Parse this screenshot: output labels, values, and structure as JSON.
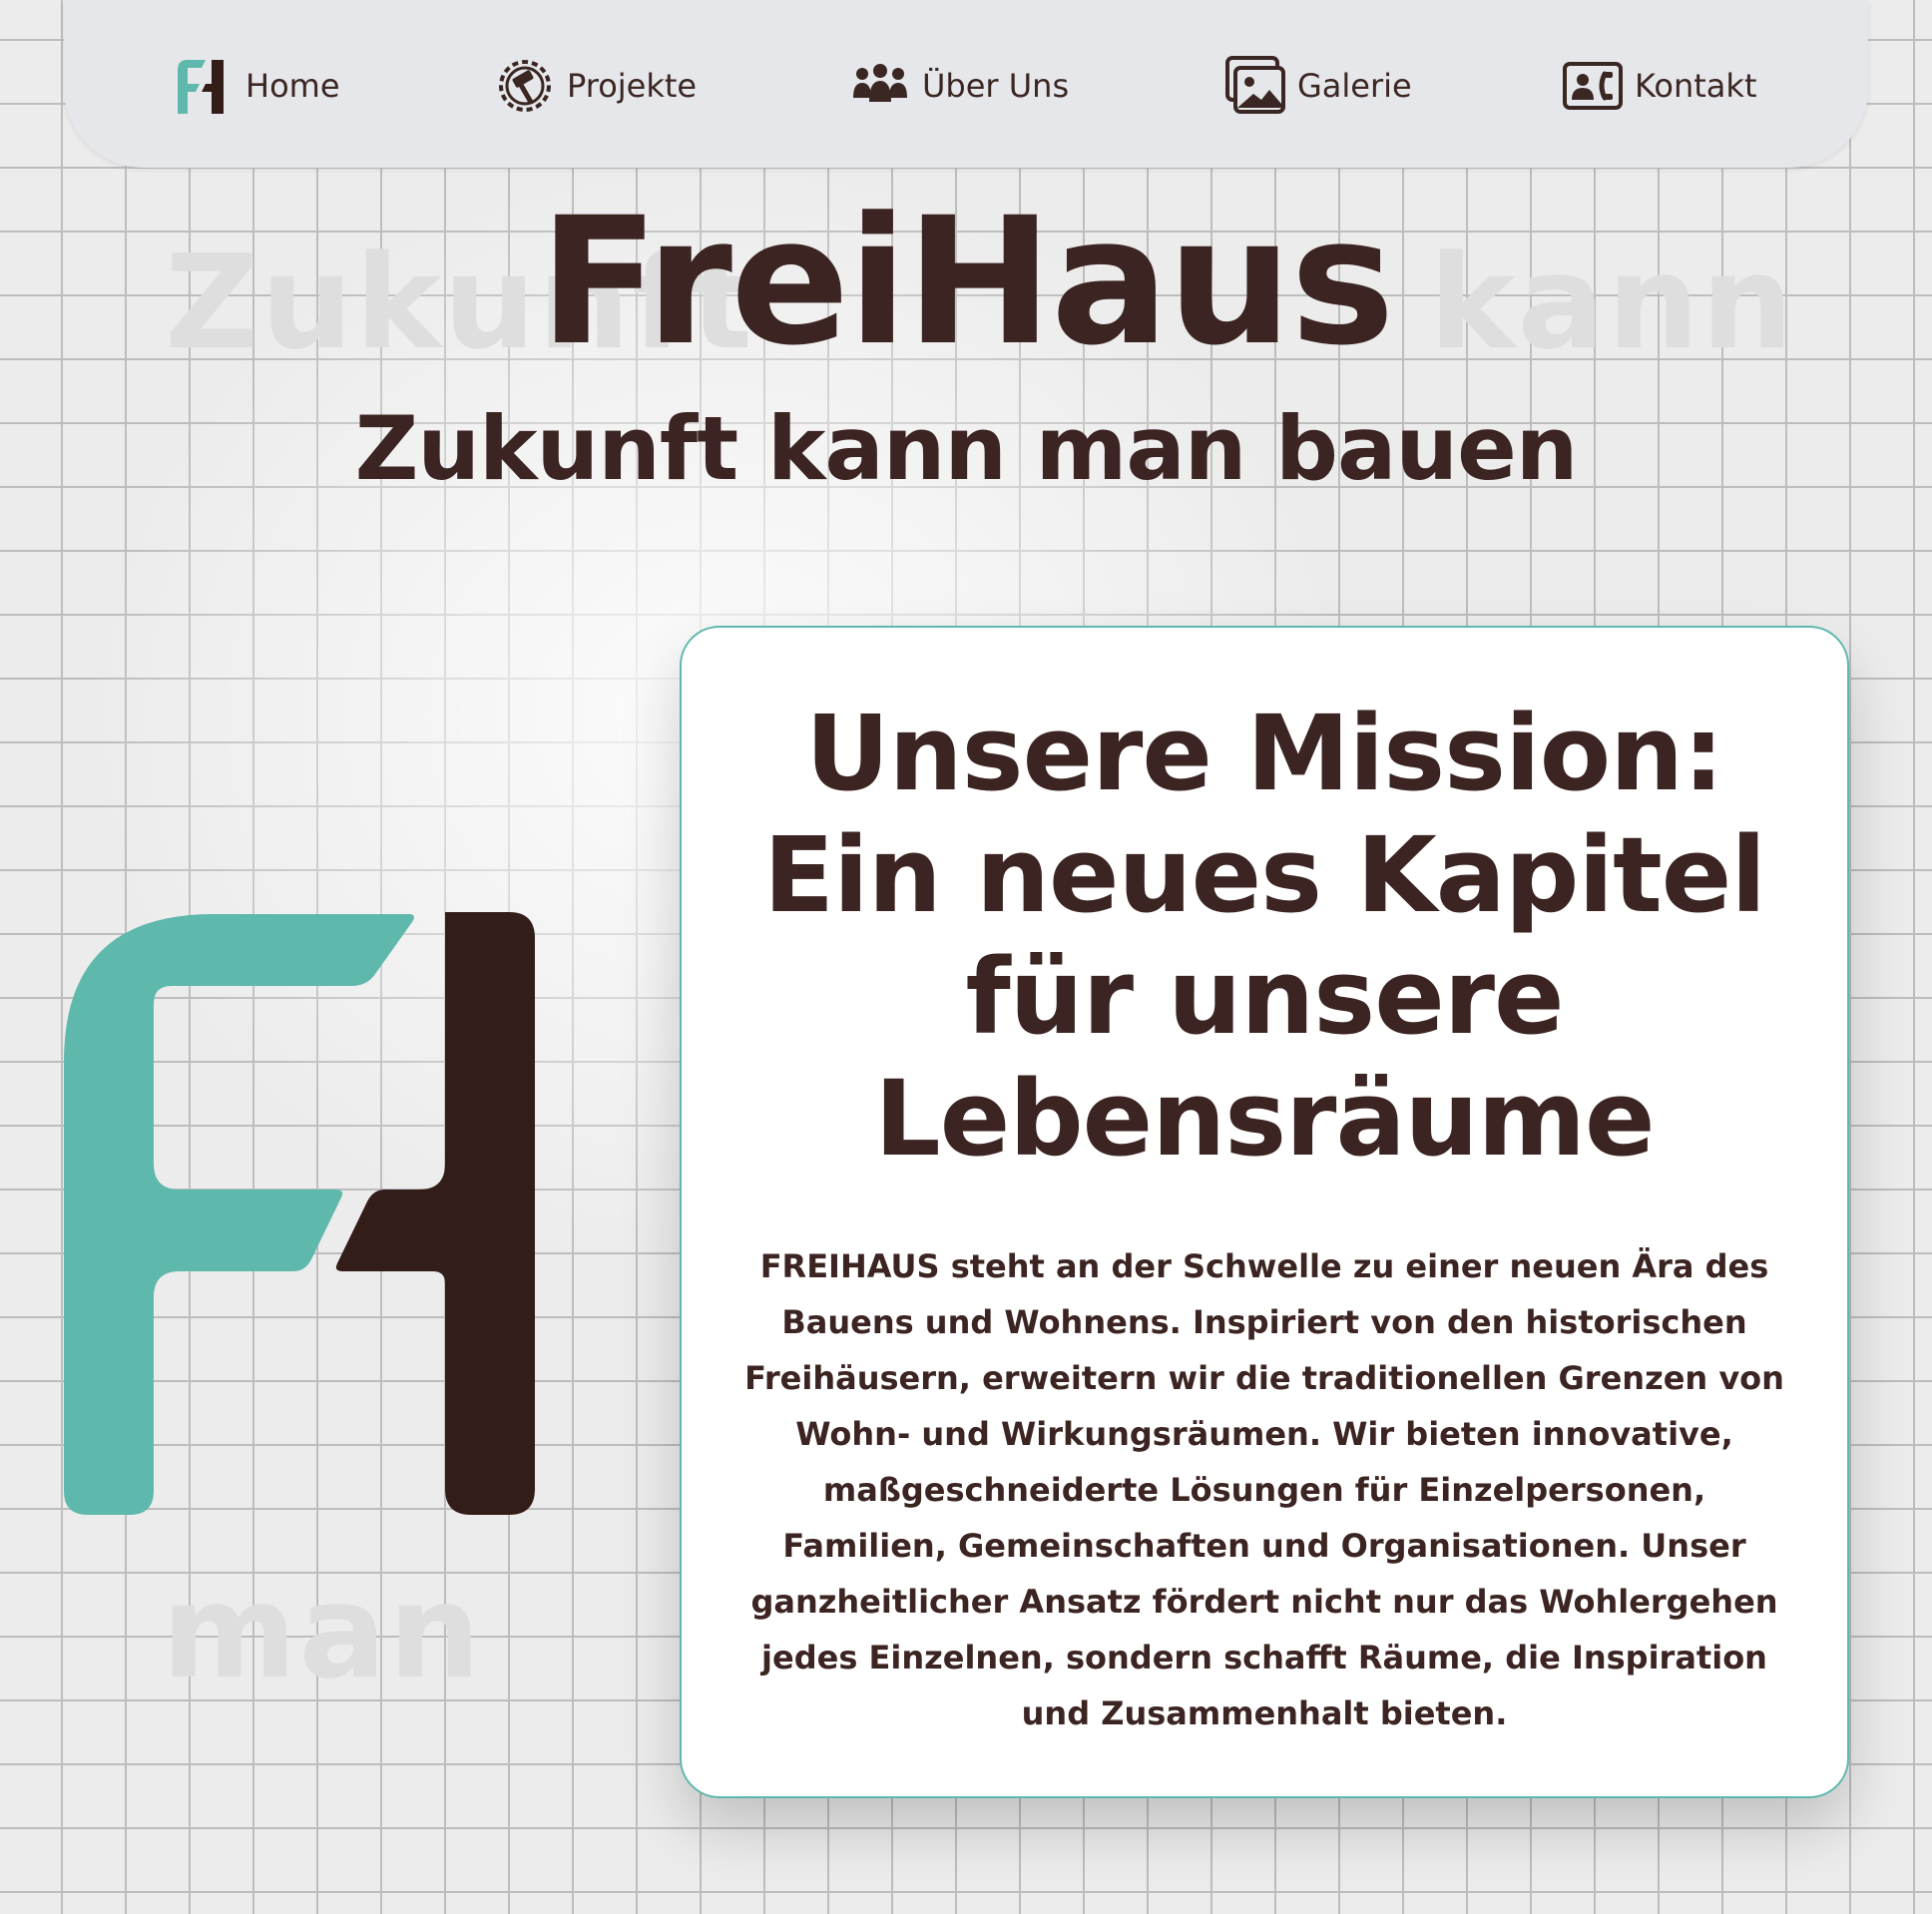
{
  "nav": {
    "items": [
      {
        "label": "Home",
        "icon": "fh-logo-icon"
      },
      {
        "label": "Projekte",
        "icon": "hammer-gear-icon"
      },
      {
        "label": "Über Uns",
        "icon": "group-icon"
      },
      {
        "label": "Galerie",
        "icon": "gallery-icon"
      },
      {
        "label": "Kontakt",
        "icon": "contact-card-icon"
      }
    ]
  },
  "hero": {
    "title": "FreiHaus",
    "subtitle": "Zukunft kann man bauen"
  },
  "mission": {
    "title": "Unsere Mission: Ein neues Kapitel für unsere Lebensräume",
    "body": "FREIHAUS steht an der Schwelle zu einer neuen Ära des Bauens und Wohnens. Inspiriert von den historischen Freihäusern, erweitern wir die traditionellen Grenzen von Wohn- und Wirkungsräumen. Wir bieten innovative, maßgeschneiderte Lösungen für Einzelpersonen, Familien, Gemeinschaften und Organisationen. Unser ganzheitlicher Ansatz fördert nicht nur das Wohlergehen jedes Einzelnen, sondern schafft Räume, die Inspiration und Zusammenhalt bieten."
  },
  "background_words": [
    "Zukunft",
    "kann",
    "man"
  ],
  "colors": {
    "teal": "#5fb8ac",
    "brown": "#331d19",
    "text": "#3b2421"
  }
}
